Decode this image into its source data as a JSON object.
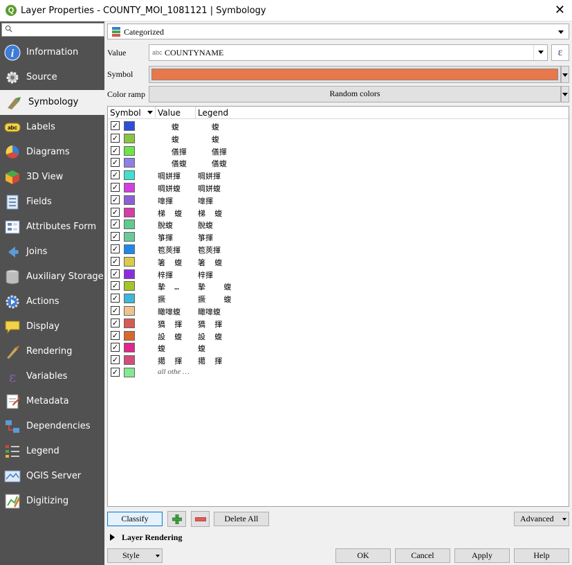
{
  "window": {
    "title": "Layer Properties - COUNTY_MOI_1081121 | Symbology",
    "close_glyph": "✕"
  },
  "sidebar": {
    "search_placeholder": "",
    "items": [
      {
        "label": "Information",
        "icon": "information-icon"
      },
      {
        "label": "Source",
        "icon": "source-icon"
      },
      {
        "label": "Symbology",
        "icon": "symbology-icon",
        "active": true
      },
      {
        "label": "Labels",
        "icon": "labels-icon"
      },
      {
        "label": "Diagrams",
        "icon": "diagrams-icon"
      },
      {
        "label": "3D View",
        "icon": "3d-view-icon"
      },
      {
        "label": "Fields",
        "icon": "fields-icon"
      },
      {
        "label": "Attributes Form",
        "icon": "attributes-form-icon"
      },
      {
        "label": "Joins",
        "icon": "joins-icon"
      },
      {
        "label": "Auxiliary Storage",
        "icon": "auxiliary-storage-icon"
      },
      {
        "label": "Actions",
        "icon": "actions-icon"
      },
      {
        "label": "Display",
        "icon": "display-icon"
      },
      {
        "label": "Rendering",
        "icon": "rendering-icon"
      },
      {
        "label": "Variables",
        "icon": "variables-icon"
      },
      {
        "label": "Metadata",
        "icon": "metadata-icon"
      },
      {
        "label": "Dependencies",
        "icon": "dependencies-icon"
      },
      {
        "label": "Legend",
        "icon": "legend-icon"
      },
      {
        "label": "QGIS Server",
        "icon": "qgis-server-icon"
      },
      {
        "label": "Digitizing",
        "icon": "digitizing-icon"
      }
    ]
  },
  "renderer": {
    "type_label": "Categorized"
  },
  "value_row": {
    "label": "Value",
    "type_badge": "abc",
    "field": "COUNTYNAME",
    "expression_glyph": "ε"
  },
  "symbol_row": {
    "label": "Symbol",
    "color": "#e8774a"
  },
  "color_ramp_row": {
    "label": "Color ramp",
    "value": "Random colors"
  },
  "table": {
    "headers": [
      "Symbol",
      "Value",
      "Legend"
    ],
    "rows": [
      {
        "checked": "✓",
        "color": "#2c4fd6",
        "value": "   蝮",
        "legend": "   蝮"
      },
      {
        "checked": "✓",
        "color": "#8ac444",
        "value": "   蝮",
        "legend": "   蝮"
      },
      {
        "checked": "✓",
        "color": "#6fe34a",
        "value": "   僐揮",
        "legend": "   僐揮"
      },
      {
        "checked": "✓",
        "color": "#8b80e4",
        "value": "   僐蝮",
        "legend": "   僐蝮"
      },
      {
        "checked": "✓",
        "color": "#3fe0d0",
        "value": "啁姘揮",
        "legend": "啁姘揮"
      },
      {
        "checked": "✓",
        "color": "#d23fe0",
        "value": "啁姘蝮",
        "legend": "啁姘蝮"
      },
      {
        "checked": "✓",
        "color": "#8c5fd4",
        "value": "嘷揮",
        "legend": "嘷揮"
      },
      {
        "checked": "✓",
        "color": "#d43ea6",
        "value": "梯  蝮",
        "legend": "梯  蝮"
      },
      {
        "checked": "✓",
        "color": "#5ecb8c",
        "value": "脫蝮",
        "legend": "脫蝮"
      },
      {
        "checked": "✓",
        "color": "#6cc99a",
        "value": "箏揮",
        "legend": "箏揮"
      },
      {
        "checked": "✓",
        "color": "#1e88e8",
        "value": "笣莢揮",
        "legend": "笣莢揮"
      },
      {
        "checked": "✓",
        "color": "#d8cc4a",
        "value": "箸  蝮",
        "legend": "箸  蝮"
      },
      {
        "checked": "✓",
        "color": "#8e2be0",
        "value": "梓揮",
        "legend": "梓揮"
      },
      {
        "checked": "✓",
        "color": "#a4c428",
        "value": "摯  …",
        "legend": "摯    蝮"
      },
      {
        "checked": "✓",
        "color": "#3db6d8",
        "value": "撅",
        "legend": "撅    蝮"
      },
      {
        "checked": "✓",
        "color": "#ecc490",
        "value": "瞰嘷蝮",
        "legend": "瞰嘷蝮"
      },
      {
        "checked": "✓",
        "color": "#d85a54",
        "value": "獢  揮",
        "legend": "獢  揮"
      },
      {
        "checked": "✓",
        "color": "#d66a2c",
        "value": "設  蝮",
        "legend": "設  蝮"
      },
      {
        "checked": "✓",
        "color": "#e0288a",
        "value": "蝮",
        "legend": "蝮"
      },
      {
        "checked": "✓",
        "color": "#d04e7a",
        "value": "擖  揮",
        "legend": "擖  揮"
      },
      {
        "checked": "✓",
        "color": "#86e890",
        "value": "all othe …",
        "legend": "",
        "italic": true
      }
    ]
  },
  "buttons": {
    "classify": "Classify",
    "add_icon": "add-category-icon",
    "remove_icon": "remove-category-icon",
    "delete_all": "Delete All",
    "advanced": "Advanced",
    "layer_rendering": "Layer Rendering",
    "style": "Style",
    "ok": "OK",
    "cancel": "Cancel",
    "apply": "Apply",
    "help": "Help"
  }
}
